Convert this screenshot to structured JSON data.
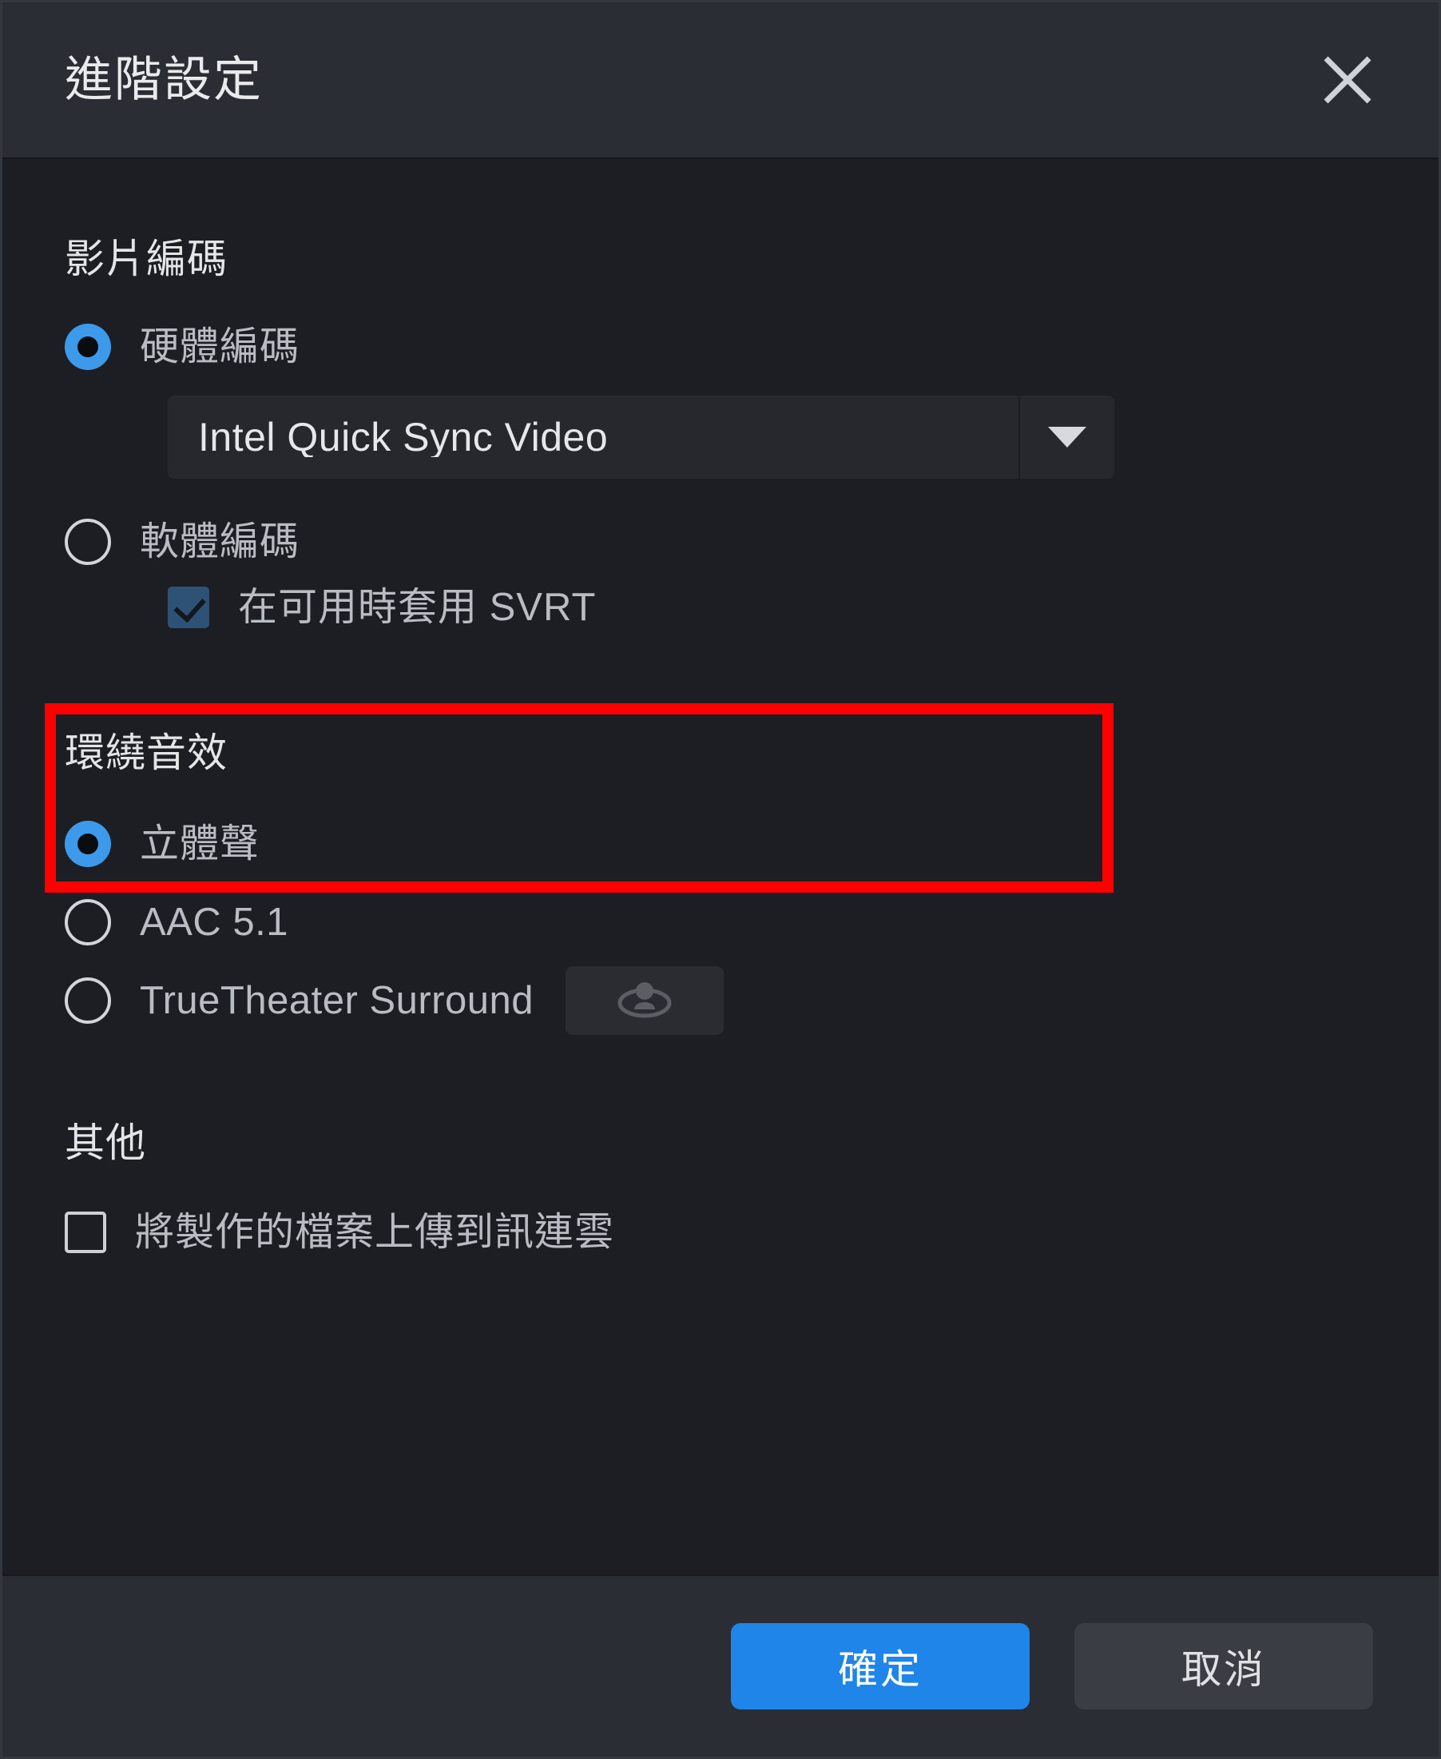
{
  "dialog": {
    "title": "進階設定",
    "close_icon": "close-icon"
  },
  "video_encoding": {
    "heading": "影片編碼",
    "hardware": {
      "label": "硬體編碼",
      "selected": true
    },
    "codec_dropdown": {
      "value": "Intel Quick Sync Video",
      "arrow_icon": "chevron-down-icon"
    },
    "software": {
      "label": "軟體編碼",
      "selected": false
    },
    "svrt": {
      "label": "在可用時套用 SVRT",
      "checked": true
    },
    "highlight_color": "#fe0000"
  },
  "surround_sound": {
    "heading": "環繞音效",
    "options": [
      {
        "label": "立體聲",
        "selected": true
      },
      {
        "label": "AAC 5.1",
        "selected": false
      },
      {
        "label": "TrueTheater Surround",
        "selected": false
      }
    ],
    "truetheater_button_icon": "surround-sound-icon"
  },
  "other": {
    "heading": "其他",
    "upload": {
      "label": "將製作的檔案上傳到訊連雲",
      "checked": false
    }
  },
  "footer": {
    "ok_label": "確定",
    "cancel_label": "取消"
  },
  "colors": {
    "accent": "#1f85e8",
    "radio_on": "#3d9aeb",
    "checkbox_on": "#2d5275",
    "titlebar_bg": "#2a2d33",
    "body_bg": "#1c1e23",
    "highlight": "#fe0000"
  }
}
